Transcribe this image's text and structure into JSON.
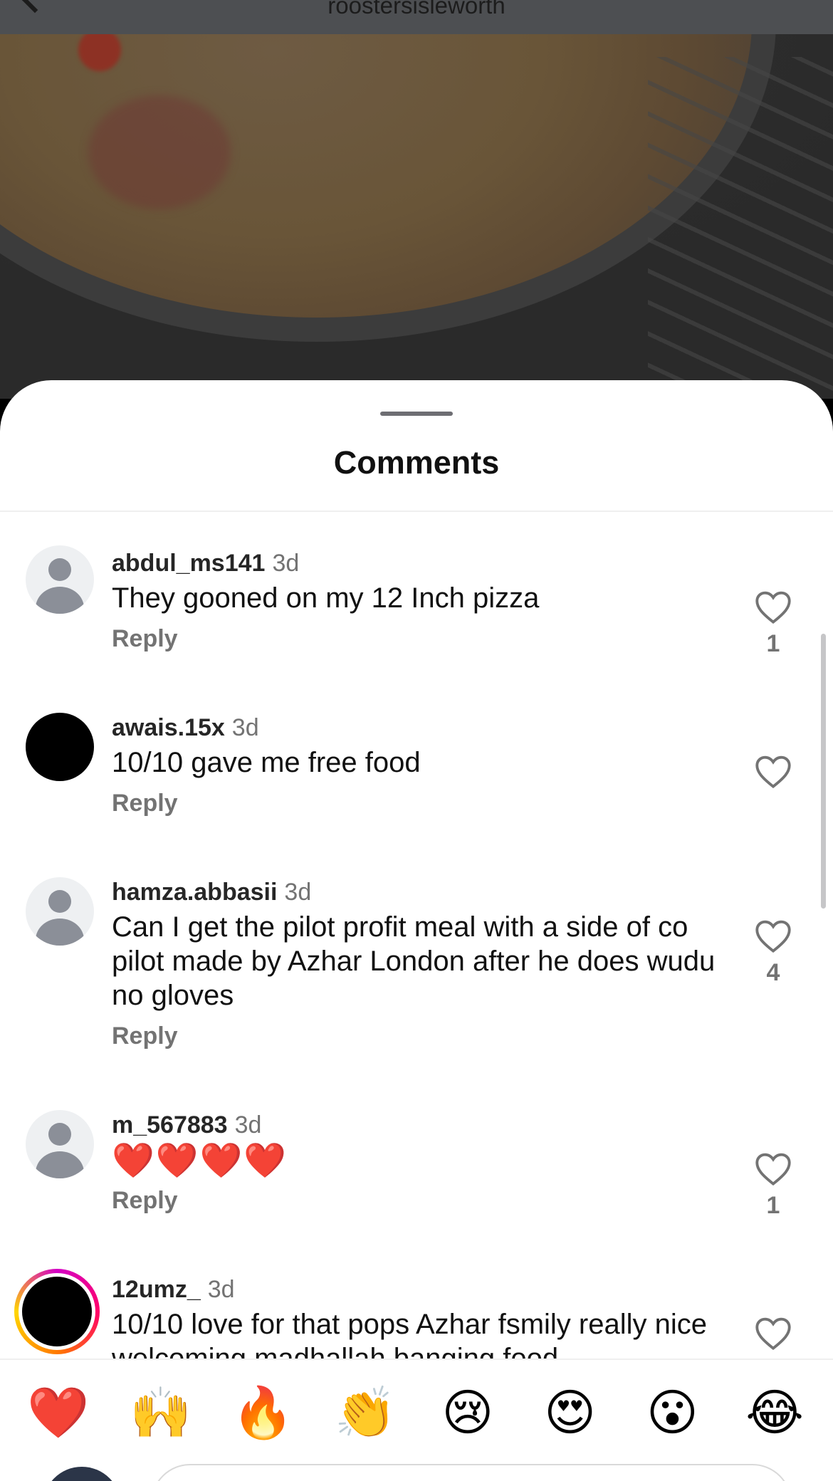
{
  "header": {
    "username": "roostersisleworth"
  },
  "sheet": {
    "title": "Comments"
  },
  "comments": [
    {
      "user": "abdul_ms141",
      "time": "3d",
      "text": "They gooned on my 12 Inch pizza",
      "reply": "Reply",
      "likes": "1"
    },
    {
      "user": "awais.15x",
      "time": "3d",
      "text": "10/10 gave me free food",
      "reply": "Reply",
      "likes": ""
    },
    {
      "user": "hamza.abbasii",
      "time": "3d",
      "text": "Can I get the pilot profit meal with a side of co pilot made by Azhar London after he does wudu no gloves",
      "reply": "Reply",
      "likes": "4"
    },
    {
      "user": "m_567883",
      "time": "3d",
      "text": "❤️❤️❤️❤️",
      "reply": "Reply",
      "likes": "1"
    },
    {
      "user": "12umz_",
      "time": "3d",
      "text": "10/10 love for that pops Azhar fsmily really nice welcoming madhallah banging food",
      "reply": "",
      "likes": ""
    }
  ],
  "reactions": [
    "❤️",
    "🙌",
    "🔥",
    "👏",
    "😢",
    "😍",
    "😮",
    "😂"
  ],
  "icons": {
    "like": "heart-outline-icon",
    "back": "chevron-left-icon"
  }
}
